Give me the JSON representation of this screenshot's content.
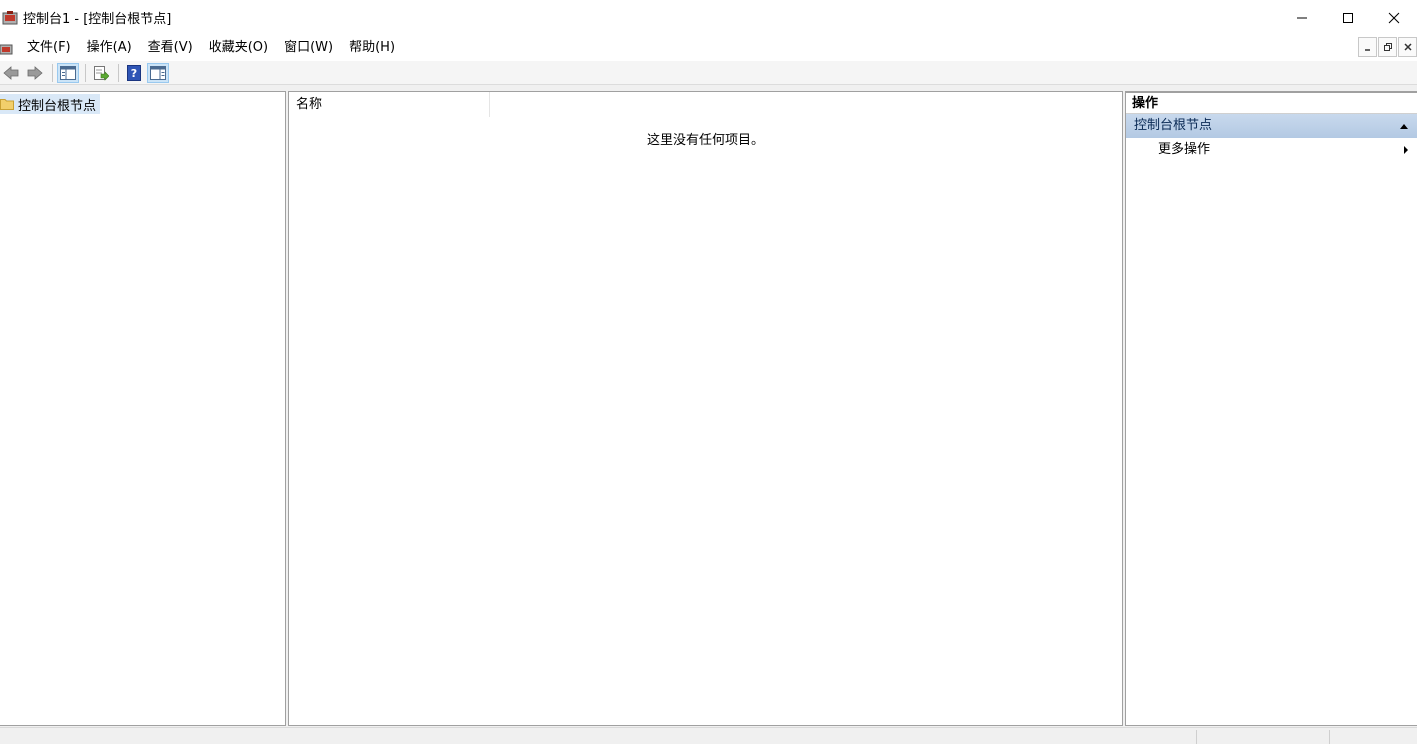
{
  "window": {
    "title": "控制台1 - [控制台根节点]",
    "icon": "mmc-console-icon",
    "controls": [
      "minimize-icon",
      "maximize-icon",
      "close-icon"
    ]
  },
  "menubar": {
    "items": [
      {
        "label": "文件(F)"
      },
      {
        "label": "操作(A)"
      },
      {
        "label": "查看(V)"
      },
      {
        "label": "收藏夹(O)"
      },
      {
        "label": "窗口(W)"
      },
      {
        "label": "帮助(H)"
      }
    ],
    "mdi_controls": [
      "mdi-minimize-icon",
      "mdi-restore-icon",
      "mdi-close-icon"
    ]
  },
  "toolbar": {
    "buttons": [
      "back-arrow-icon",
      "forward-arrow-icon",
      "show-hide-console-tree-icon",
      "export-list-icon",
      "help-icon",
      "show-hide-action-pane-icon"
    ]
  },
  "tree": {
    "root_label": "控制台根节点"
  },
  "list": {
    "columns": [
      "名称"
    ],
    "empty_message": "这里没有任何项目。"
  },
  "actions": {
    "title": "操作",
    "section_label": "控制台根节点",
    "items": [
      {
        "label": "更多操作"
      }
    ]
  },
  "colors": {
    "selection": "#d9e8f7",
    "section_header": "#b3c9e3",
    "pane_border": "#a0a0a0"
  }
}
